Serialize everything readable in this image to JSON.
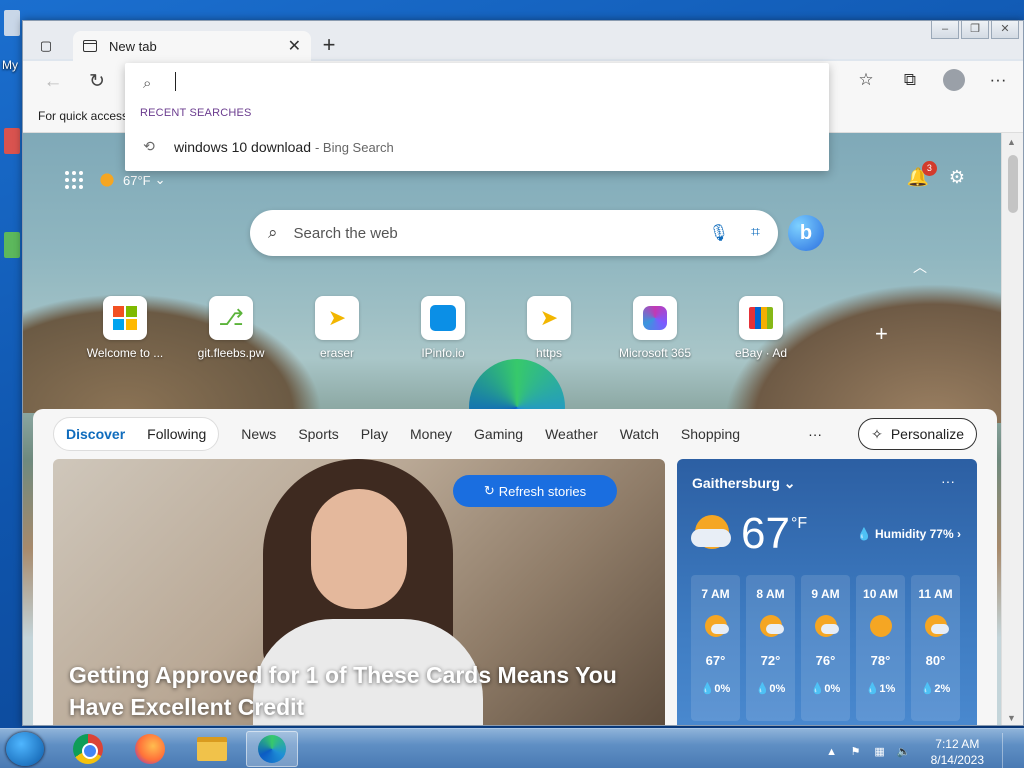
{
  "desktop": {
    "label_fragment": "My"
  },
  "browser": {
    "tab": {
      "title": "New tab"
    },
    "favorites_bar": {
      "text": "For quick access"
    },
    "address_dropdown": {
      "recent_label": "RECENT SEARCHES",
      "recent_items": [
        {
          "query": "windows 10 download",
          "suffix": "- Bing Search"
        }
      ]
    }
  },
  "ntp": {
    "weather_temp": "67°F",
    "notification_count": "3",
    "search_placeholder": "Search the web",
    "quick_links": [
      {
        "label": "Welcome to ...",
        "icon": "microsoft-icon"
      },
      {
        "label": "git.fleebs.pw",
        "icon": "git-icon"
      },
      {
        "label": "eraser",
        "icon": "cursor-icon"
      },
      {
        "label": "IPinfo.io",
        "icon": "ipinfo-icon"
      },
      {
        "label": "https",
        "icon": "cursor-icon"
      },
      {
        "label": "Microsoft 365",
        "icon": "m365-icon"
      },
      {
        "label": "eBay · Ad",
        "icon": "ebay-bag-icon"
      }
    ]
  },
  "feed": {
    "pill_tabs": [
      "Discover",
      "Following"
    ],
    "categories": [
      "News",
      "Sports",
      "Play",
      "Money",
      "Gaming",
      "Weather",
      "Watch",
      "Shopping"
    ],
    "more": "···",
    "personalize": "Personalize",
    "refresh": "Refresh stories",
    "hero_title": "Getting Approved for 1 of These Cards Means You Have Excellent Credit"
  },
  "weather": {
    "city": "Gaithersburg",
    "temp": "67",
    "unit": "°F",
    "humidity": "Humidity 77%",
    "hours": [
      {
        "time": "7 AM",
        "temp": "67°",
        "precip": "0%",
        "icon": "partly-cloudy"
      },
      {
        "time": "8 AM",
        "temp": "72°",
        "precip": "0%",
        "icon": "partly-cloudy"
      },
      {
        "time": "9 AM",
        "temp": "76°",
        "precip": "0%",
        "icon": "partly-cloudy"
      },
      {
        "time": "10 AM",
        "temp": "78°",
        "precip": "1%",
        "icon": "sunny"
      },
      {
        "time": "11 AM",
        "temp": "80°",
        "precip": "2%",
        "icon": "partly-cloudy"
      }
    ]
  },
  "taskbar": {
    "time": "7:12 AM",
    "date": "8/14/2023"
  }
}
